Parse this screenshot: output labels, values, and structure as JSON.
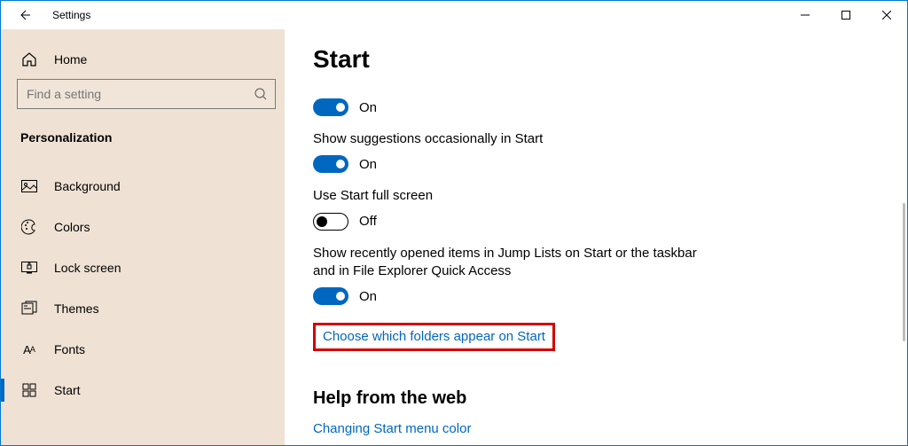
{
  "titlebar": {
    "title": "Settings"
  },
  "sidebar": {
    "home": "Home",
    "searchPlaceholder": "Find a setting",
    "section": "Personalization",
    "items": [
      {
        "label": "Background"
      },
      {
        "label": "Colors"
      },
      {
        "label": "Lock screen"
      },
      {
        "label": "Themes"
      },
      {
        "label": "Fonts"
      },
      {
        "label": "Start"
      }
    ]
  },
  "main": {
    "heading": "Start",
    "settings": [
      {
        "label": "",
        "value": "On",
        "on": true,
        "showLabel": false
      },
      {
        "label": "Show suggestions occasionally in Start",
        "value": "On",
        "on": true,
        "showLabel": true
      },
      {
        "label": "Use Start full screen",
        "value": "Off",
        "on": false,
        "showLabel": true
      },
      {
        "label": "Show recently opened items in Jump Lists on Start or the taskbar and in File Explorer Quick Access",
        "value": "On",
        "on": true,
        "showLabel": true
      }
    ],
    "link": "Choose which folders appear on Start",
    "help": {
      "heading": "Help from the web",
      "link": "Changing Start menu color"
    }
  }
}
